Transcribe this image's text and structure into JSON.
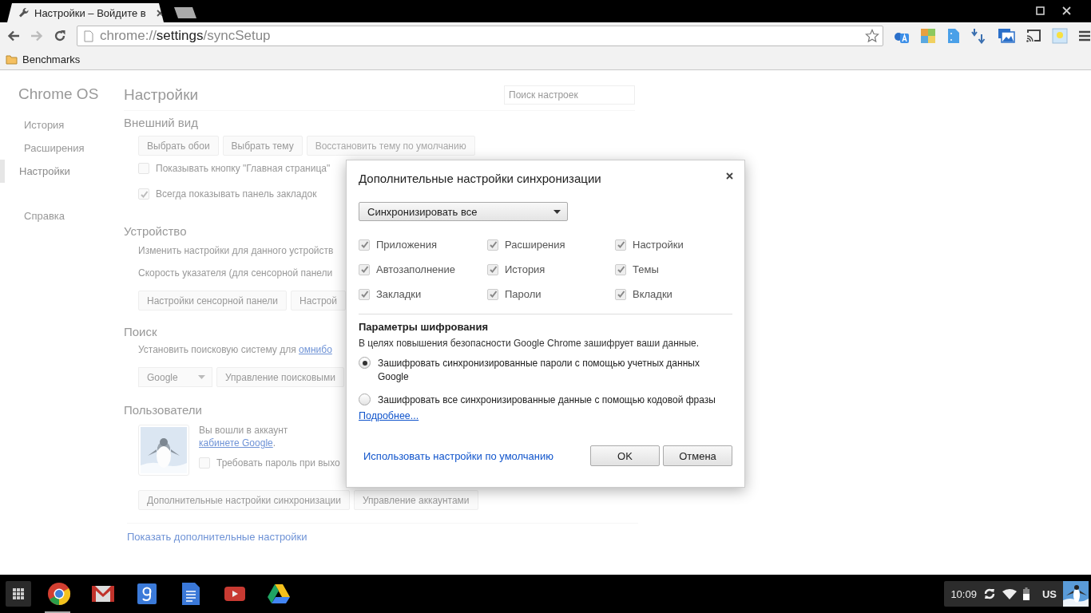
{
  "tabs": [
    {
      "title": "Настройки – Войдите в",
      "selected": true
    }
  ],
  "omnibox": {
    "scheme": "chrome://",
    "host": "settings",
    "path": "/syncSetup"
  },
  "bookmarks": [
    {
      "label": "Benchmarks"
    }
  ],
  "sidebar": {
    "title": "Chrome OS",
    "items": [
      {
        "label": "История",
        "selected": false
      },
      {
        "label": "Расширения",
        "selected": false
      },
      {
        "label": "Настройки",
        "selected": true
      },
      {
        "label": "Справка",
        "selected": false
      }
    ]
  },
  "page": {
    "title": "Настройки",
    "search_placeholder": "Поиск настроек",
    "appearance": {
      "heading": "Внешний вид",
      "buttons": [
        {
          "label": "Выбрать обои",
          "disabled": false
        },
        {
          "label": "Выбрать тему",
          "disabled": false
        },
        {
          "label": "Восстановить тему по умолчанию",
          "disabled": true
        }
      ],
      "checkboxes": [
        {
          "label": "Показывать кнопку \"Главная страница\"",
          "checked": false
        },
        {
          "label": "Всегда показывать панель закладок",
          "checked": true
        }
      ]
    },
    "device": {
      "heading": "Устройство",
      "texts": [
        "Изменить настройки для данного устройств",
        "Скорость указателя (для сенсорной панели"
      ],
      "buttons": [
        "Настройки сенсорной панели",
        "Настрой"
      ]
    },
    "search": {
      "heading": "Поиск",
      "text": "Установить поисковую систему для",
      "link": "омнибо",
      "engine": "Google",
      "button": "Управление поисковыми"
    },
    "users": {
      "heading": "Пользователи",
      "text": "Вы вошли в аккаунт",
      "link": "кабинете Google",
      "suffix": ".",
      "checkbox": {
        "label": "Требовать пароль при выхо",
        "checked": false
      },
      "buttons": [
        "Дополнительные настройки синхронизации",
        "Управление аккаунтами"
      ]
    },
    "show_more": "Показать дополнительные настройки"
  },
  "dialog": {
    "title": "Дополнительные настройки синхронизации",
    "select": "Синхронизировать все",
    "data_types": [
      {
        "label": "Приложения",
        "checked": true
      },
      {
        "label": "Расширения",
        "checked": true
      },
      {
        "label": "Настройки",
        "checked": true
      },
      {
        "label": "Автозаполнение",
        "checked": true
      },
      {
        "label": "История",
        "checked": true
      },
      {
        "label": "Темы",
        "checked": true
      },
      {
        "label": "Закладки",
        "checked": true
      },
      {
        "label": "Пароли",
        "checked": true
      },
      {
        "label": "Вкладки",
        "checked": true
      }
    ],
    "encryption_heading": "Параметры шифрования",
    "encryption_text": "В целях повышения безопасности Google Chrome зашифрует ваши данные.",
    "options": [
      {
        "label": "Зашифровать синхронизированные пароли с помощью учетных данных Google",
        "selected": true
      },
      {
        "label": "Зашифровать все синхронизированные данные с помощью кодовой фразы",
        "selected": false
      }
    ],
    "more_link": "Подробнее...",
    "defaults_link": "Использовать настройки по умолчанию",
    "buttons": [
      "OK",
      "Отмена"
    ]
  },
  "shelf": {
    "apps": [
      {
        "kind": "chrome",
        "running": true
      },
      {
        "kind": "mail",
        "running": false
      },
      {
        "kind": "search",
        "running": false
      },
      {
        "kind": "docs",
        "running": false
      },
      {
        "kind": "video",
        "running": false
      },
      {
        "kind": "drive",
        "running": false
      }
    ],
    "time": "10:09",
    "keyboard": "US"
  }
}
